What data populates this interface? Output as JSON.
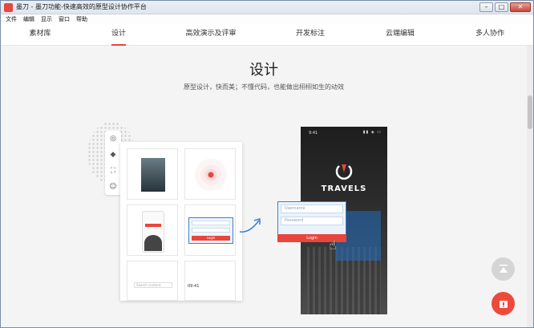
{
  "window": {
    "title": "墨刀 - 墨刀功能-快速高效的原型设计协作平台"
  },
  "menubar": [
    "文件",
    "编辑",
    "显示",
    "窗口",
    "帮助"
  ],
  "tabs": [
    {
      "label": "素材库"
    },
    {
      "label": "设计",
      "active": true
    },
    {
      "label": "高效演示及评审"
    },
    {
      "label": "开发标注"
    },
    {
      "label": "云端编辑"
    },
    {
      "label": "多人协作"
    }
  ],
  "hero": {
    "title": "设计",
    "subtitle": "原型设计，快而美；不懂代码，也能做出栩栩如生的动效"
  },
  "mockup": {
    "brand": "TRAVELS",
    "phone_time": "9:41",
    "username_placeholder": "Username",
    "password_placeholder": "Password",
    "login_label": "Login",
    "card_login_label": "Login",
    "card_search": "Search content",
    "card_time": "09:41"
  },
  "colors": {
    "accent": "#e8453c",
    "selection": "#3b7fd1"
  },
  "icons": [
    "app-icon",
    "target-icon",
    "cube-icon",
    "crop-icon",
    "emoji-icon",
    "arrow-icon",
    "hand-cursor-icon",
    "back-to-top-icon",
    "feedback-icon"
  ]
}
